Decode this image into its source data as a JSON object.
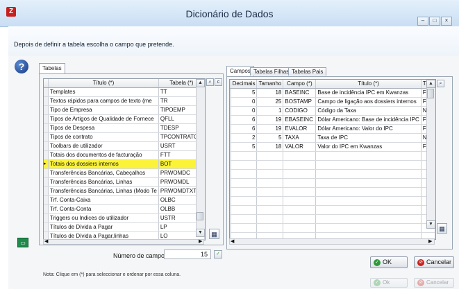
{
  "window": {
    "title": "Dicionário de Dados"
  },
  "instruction": "Depois de definir a tabela escolha o campo que pretende.",
  "left_tab": "Tabelas",
  "tables": {
    "columns": [
      "Título (*)",
      "Tabela (*)"
    ],
    "rows": [
      [
        "Templates",
        "TT"
      ],
      [
        "Textos rápidos para campos de texto (me",
        "TR"
      ],
      [
        "Tipo de Empresa",
        "TIPOEMP"
      ],
      [
        "Tipos de Artigos de Qualidade de Fornece",
        "QFLL"
      ],
      [
        "Tipos de Despesa",
        "TDESP"
      ],
      [
        "Tipos de contrato",
        "TPCONTRATO"
      ],
      [
        "Toolbars de utilizador",
        "USRT"
      ],
      [
        "Totais dos documentos de facturação",
        "FTT"
      ],
      [
        "Totais dos dossiers internos",
        "BOT"
      ],
      [
        "Transferências Bancárias, Cabeçalhos",
        "PRWOMDC"
      ],
      [
        "Transferências Bancárias, Linhas",
        "PRWOMDL"
      ],
      [
        "Transferências Bancárias, Linhas (Modo Te",
        "PRWOMDTXT"
      ],
      [
        "Trf. Conta-Caixa",
        "OLBC"
      ],
      [
        "Trf. Conta-Conta",
        "OLBB"
      ],
      [
        "Triggers ou Indices do utilizador",
        "USTR"
      ],
      [
        "Títulos de Dívida a Pagar",
        "LP"
      ],
      [
        "Títulos de Dívida a Pagar,linhas",
        "LO"
      ]
    ],
    "selected_index": 8
  },
  "right_tabs": [
    "Campos",
    "Tabelas Filhas",
    "Tabelas Pais"
  ],
  "fields": {
    "columns": [
      "Decimais",
      "Tamanho",
      "Campo (*)",
      "Título (*)",
      "Tipo"
    ],
    "rows": [
      [
        "5",
        "18",
        "BASEINC",
        "Base de incidência IPC em Kwanzas",
        "FN"
      ],
      [
        "0",
        "25",
        "BOSTAMP",
        "Campo de ligação aos dossiers internos",
        "FC"
      ],
      [
        "0",
        "1",
        "CODIGO",
        "Código da Taxa",
        "N"
      ],
      [
        "6",
        "19",
        "EBASEINC",
        "Dólar Americano: Base de incidência IPC",
        "FN"
      ],
      [
        "6",
        "19",
        "EVALOR",
        "Dólar Americano: Valor do IPC",
        "FN"
      ],
      [
        "2",
        "5",
        "TAXA",
        "Taxa de IPC",
        "N"
      ],
      [
        "5",
        "18",
        "VALOR",
        "Valor do IPC em Kwanzas",
        "FN"
      ]
    ]
  },
  "field_count": {
    "label": "Número de campos",
    "value": "15"
  },
  "buttons": {
    "ok": "OK",
    "cancel": "Cancelar",
    "ok_ghost": "Ok",
    "cancel_ghost": "Cancelar"
  },
  "note": "Nota: Clique em (*) para seleccionar e ordenar por essa coluna.",
  "colors": {
    "selection": "#fbf33a",
    "title_bar": "#c9def3"
  }
}
